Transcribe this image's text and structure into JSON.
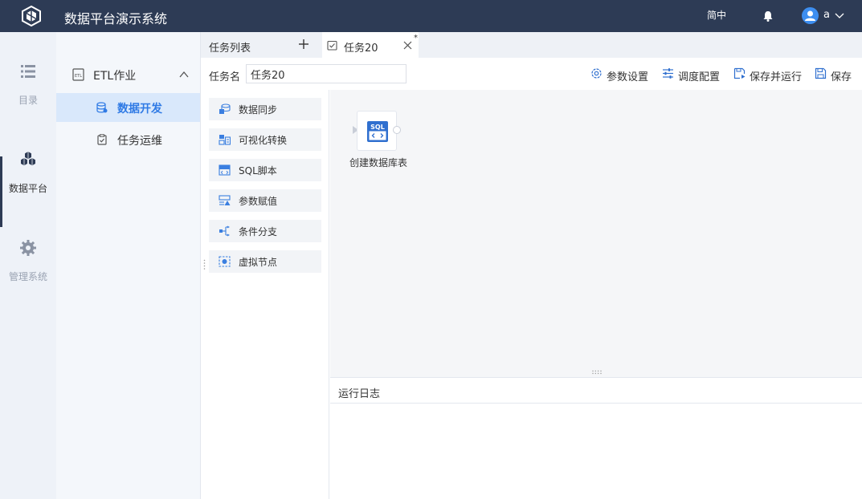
{
  "header": {
    "title": "数据平台演示系统",
    "lang": "简中",
    "user": "a"
  },
  "rail": {
    "items": [
      {
        "label": "目录",
        "icon": "list-icon"
      },
      {
        "label": "数据平台",
        "icon": "cubes-icon"
      },
      {
        "label": "管理系统",
        "icon": "gear-icon"
      }
    ]
  },
  "submenu": {
    "group_label": "ETL作业",
    "items": [
      {
        "label": "数据开发",
        "icon": "database-icon"
      },
      {
        "label": "任务运维",
        "icon": "clipboard-icon"
      }
    ]
  },
  "tabs": {
    "list_label": "任务列表",
    "task_label": "任务20",
    "dirty_mark": "*"
  },
  "toolbar": {
    "task_name_label": "任务名",
    "task_name_value": "任务20",
    "params_label": "参数设置",
    "schedule_label": "调度配置",
    "save_run_label": "保存并运行",
    "save_label": "保存"
  },
  "palette": {
    "items": [
      {
        "label": "数据同步",
        "icon": "sync-icon"
      },
      {
        "label": "可视化转换",
        "icon": "transform-icon"
      },
      {
        "label": "SQL脚本",
        "icon": "sql-icon"
      },
      {
        "label": "参数赋值",
        "icon": "param-icon"
      },
      {
        "label": "条件分支",
        "icon": "branch-icon"
      },
      {
        "label": "虚拟节点",
        "icon": "virtual-node-icon"
      }
    ]
  },
  "canvas": {
    "node": {
      "label": "创建数据库表",
      "icon_text": "SQL"
    }
  },
  "log": {
    "title": "运行日志"
  },
  "colors": {
    "header_bg": "#2d3b55",
    "accent": "#2f7ae5",
    "active_menu_bg": "#d9e8fb",
    "avatar": "#3d8ef0"
  }
}
